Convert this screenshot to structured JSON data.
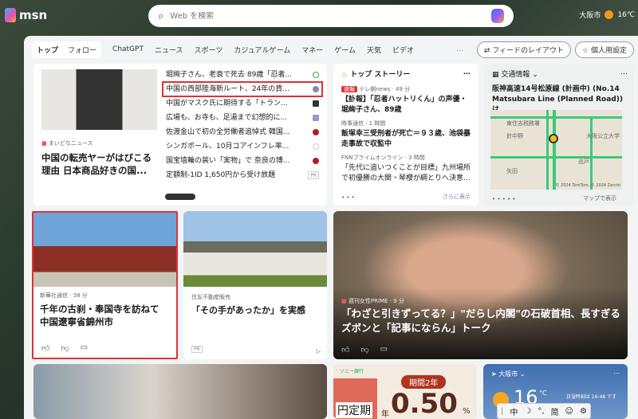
{
  "header": {
    "logo": "msn",
    "search_placeholder": "Web を検索",
    "location": "大阪市",
    "temp": "16℃"
  },
  "nav": {
    "tabs": [
      "トップ",
      "フォロー"
    ],
    "items": [
      "ChatGPT",
      "ニュース",
      "スポーツ",
      "カジュアルゲーム",
      "マネー",
      "ゲーム",
      "天気",
      "ビデオ"
    ],
    "more": "…",
    "layout_btn": "フィードのレイアウト",
    "personalize_btn": "個人用設定"
  },
  "hero": {
    "source": "まいどなニュース",
    "title": "中国の転売ヤーがはびこる理由 日本商品好きの国...",
    "list": [
      "堀絢子さん、老衰で死去 89歳「忍者...",
      "中国の西部陸海新ルート、24年の貨...",
      "中国がマスク氏に期待する「トラン...",
      "広場も、お寺も、足湯まで幻想的に...",
      "佐渡金山で初の全労働者追悼式 韓国...",
      "シンガポール、10月コアインフレ率...",
      "国宝埴輪の装い「実物」で 奈良の博...",
      "定額制-1ID 1,650円から受け放題"
    ],
    "pr": "PR"
  },
  "top_stories": {
    "title": "トップ ストーリー",
    "more": "…",
    "items": [
      {
        "badge": "速報",
        "source": "テレ朝news · 49 分",
        "headline": "【訃報】「忍者ハットリくん」の声優・堀絢子さん、89歳"
      },
      {
        "source": "時事通信 · 1 時間",
        "headline": "飯塚幸三受刑者が死亡＝９３歳、池袋暴走事故で収監中"
      },
      {
        "source": "FNNプライムオンライン · 3 時間",
        "headline": "「先代に追いつくことが目標」九州場所で初優勝の大関・琴櫻が綱とりへ決意..."
      }
    ],
    "show_more": "さらに表示"
  },
  "traffic": {
    "title": "交通情報",
    "more": "…",
    "headline": "阪神高速14号松原線 (計画中) (No.14 Matsubara Line (Planned Road))は...",
    "map_labels": [
      "東住吉税務署",
      "針中野",
      "矢田",
      "大阪公立大学",
      "出戸"
    ],
    "copyright": "© 2024 TomTom, © 2024 Zenrin",
    "show_map": "マップで表示"
  },
  "card_temple": {
    "source": "新華社通信 · 38 分",
    "title": "千年の古刹・奉国寺を訪ねて 中国遼寧省錦州市"
  },
  "card_house": {
    "source": "住友不動産販売",
    "title": "「その手があったか」を実感",
    "pr": "PR"
  },
  "card_pm": {
    "source": "週刊女性PRIME · 9 分",
    "title": "「わざと引きずってる？」\"だらし内閣\"の石破首相、長すぎるズボンと「記事にならん」トーク"
  },
  "ad_sony": {
    "brand": "ソニー銀行",
    "period": "期間2年",
    "product": "円定期",
    "year": "年",
    "rate": "0.50",
    "unit": "%"
  },
  "weather": {
    "city": "大阪市",
    "more": "…",
    "temp": "16",
    "unit": "°C",
    "note": "日没時刻は 16:48 です"
  },
  "ime": {
    "items": [
      "中",
      "☽",
      "°,",
      "简",
      "☺",
      "⚙"
    ]
  }
}
